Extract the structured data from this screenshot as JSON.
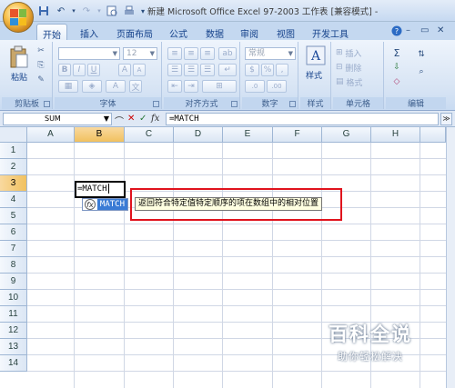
{
  "window": {
    "title": "新建 Microsoft Office Excel 97-2003 工作表 [兼容模式] -"
  },
  "ribbon_tabs": [
    "开始",
    "插入",
    "页面布局",
    "公式",
    "数据",
    "审阅",
    "视图",
    "开发工具"
  ],
  "ribbon_groups": {
    "clipboard": {
      "label": "剪贴板",
      "paste": "粘贴"
    },
    "font": {
      "label": "字体",
      "font_size": "12",
      "bold": "B",
      "italic": "I",
      "underline": "U",
      "color_a": "A",
      "size_up": "A",
      "size_down": "A"
    },
    "alignment": {
      "label": "对齐方式"
    },
    "number": {
      "label": "数字",
      "format": "常规",
      "percent": "%",
      "comma": ","
    },
    "styles": {
      "label": "样式",
      "button": "样式"
    },
    "cells": {
      "label": "单元格",
      "insert": "插入",
      "delete": "删除",
      "format": "格式"
    },
    "editing": {
      "label": "编辑",
      "sum": "Σ"
    }
  },
  "formula_bar": {
    "name_box": "SUM",
    "cancel": "✕",
    "enter": "✓",
    "fx": "fx",
    "content": "=MATCH"
  },
  "columns": [
    "A",
    "B",
    "C",
    "D",
    "E",
    "F",
    "G",
    "H"
  ],
  "rows": [
    "1",
    "2",
    "3",
    "4",
    "5",
    "6",
    "7",
    "8",
    "9",
    "10",
    "11",
    "12",
    "13",
    "14"
  ],
  "active_cell": {
    "ref": "B3",
    "text": "=MATCH"
  },
  "autocomplete": {
    "item": "MATCH"
  },
  "tooltip": {
    "text": "返回符合特定值特定顺序的项在数组中的相对位置"
  },
  "highlight_color": "#e0131d",
  "watermark": {
    "title": "百科全说",
    "subtitle": "助你轻松解决"
  }
}
